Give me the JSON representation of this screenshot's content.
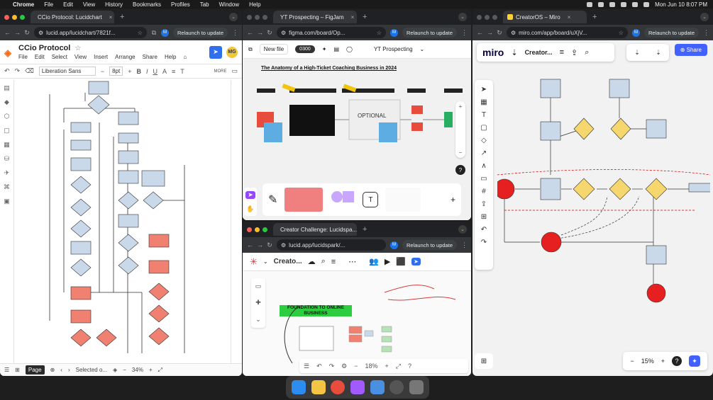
{
  "menubar": {
    "items": [
      "Chrome",
      "File",
      "Edit",
      "View",
      "History",
      "Bookmarks",
      "Profiles",
      "Tab",
      "Window",
      "Help"
    ],
    "clock": "Mon Jun 10  8:07 PM"
  },
  "lucid_window": {
    "tab_title": "CCio Protocol: Lucidchart",
    "url": "lucid.app/lucidchart/7821f...",
    "relaunch": "Relaunch to update",
    "profile_initial": "M",
    "doc_title": "CCio Protocol",
    "menu": [
      "File",
      "Edit",
      "Select",
      "View",
      "Insert",
      "Arrange",
      "Share",
      "Help"
    ],
    "user_initials": "MG",
    "font": "Liberation Sans",
    "font_size": "8pt",
    "more_label": "MORE",
    "footer": {
      "page_tab": "Page",
      "selected": "Selected o...",
      "zoom": "34%"
    }
  },
  "figma_window": {
    "tab_title": "YT Prospecting – FigJam",
    "url": "figma.com/board/Op...",
    "relaunch": "Relaunch to update",
    "profile_initial": "M",
    "new_file": "New file",
    "timer": "0300",
    "board_name": "YT Prospecting",
    "canvas_title": "The Anatomy of a High-Ticket Coaching Business in 2024",
    "optional_label": "OPTIONAL",
    "t_label": "T"
  },
  "spark_window": {
    "tab_title": "Creator Challenge: Lucidspa...",
    "url": "lucid.app/lucidspark/...",
    "relaunch": "Relaunch to update",
    "profile_initial": "M",
    "title": "Creato...",
    "banner": "FOUNDATION TO ONLINE BUSINESS",
    "zoom": "18%"
  },
  "miro_window": {
    "tab_title": "CreatorOS – Miro",
    "url": "miro.com/app/board/uXjV...",
    "relaunch": "Relaunch to update",
    "profile_initial": "M",
    "logo": "miro",
    "board_name": "Creator...",
    "share": "Share",
    "zoom": "15%"
  },
  "colors": {
    "lucid_orange": "#f96b13",
    "figma_red": "#e74c3c",
    "miro_blue": "#4262ff",
    "miro_red_node": "#e62020",
    "diamond_yellow": "#f5d76e",
    "node_blue": "#c9d9ea",
    "node_salmon": "#f08070",
    "green_banner": "#2ecc40"
  }
}
